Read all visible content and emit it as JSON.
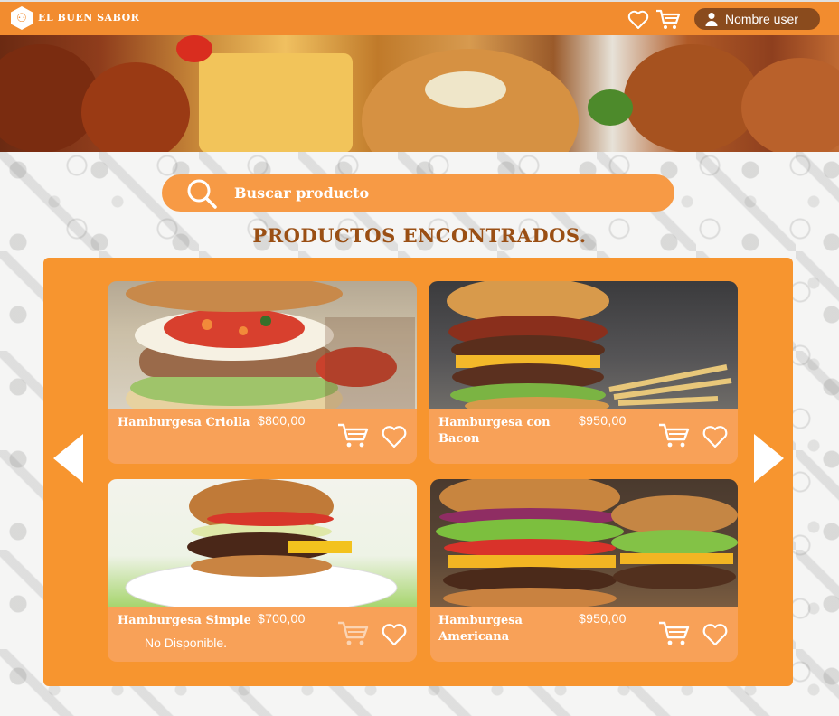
{
  "header": {
    "logo_text": "EL BUEN SABOR",
    "user_label": "Nombre user",
    "icons": [
      "heart-icon",
      "cart-icon",
      "user-icon"
    ]
  },
  "search": {
    "placeholder": "Buscar producto"
  },
  "section_title": "PRODUCTOS ENCONTRADOS.",
  "products": [
    {
      "name": "Hamburgesa Criolla",
      "price": "$800,00",
      "status": ""
    },
    {
      "name": "Hamburgesa con Bacon",
      "price": "$950,00",
      "status": ""
    },
    {
      "name": "Hamburgesa Simple",
      "price": "$700,00",
      "status": "No Disponible."
    },
    {
      "name": "Hamburgesa Americana",
      "price": "$950,00",
      "status": ""
    }
  ],
  "colors": {
    "brand": "#f28c2f",
    "panel": "#f7952f",
    "card_info": "#f8a158",
    "title": "#9a4f14",
    "user_pill": "#8a4b1d"
  }
}
